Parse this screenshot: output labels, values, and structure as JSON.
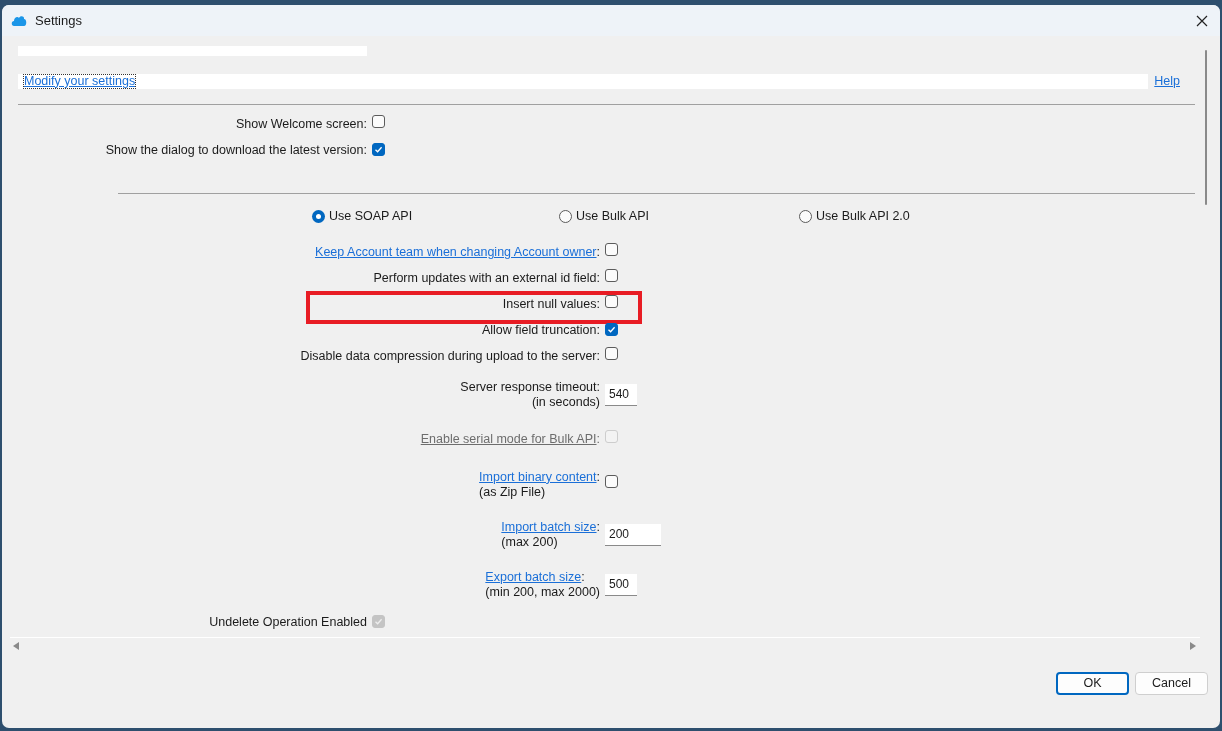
{
  "window": {
    "title": "Settings"
  },
  "header": {
    "link": "Modify your settings",
    "help": "Help"
  },
  "general": [
    {
      "label": "Show Welcome screen:",
      "checked": false
    },
    {
      "label": "Show the dialog to download the latest version:",
      "checked": true
    }
  ],
  "api_modes": [
    {
      "label": "Use SOAP API",
      "selected": true
    },
    {
      "label": "Use Bulk API",
      "selected": false
    },
    {
      "label": "Use Bulk API 2.0",
      "selected": false
    }
  ],
  "options": [
    {
      "kind": "checkbox",
      "text": "Keep Account team when changing Account owner",
      "suffix": ":",
      "link": true,
      "checked": false,
      "disabled": false
    },
    {
      "kind": "checkbox",
      "text": "Perform updates with an external id field:",
      "link": false,
      "checked": false,
      "disabled": false
    },
    {
      "kind": "checkbox",
      "text": "Insert null values:",
      "link": false,
      "checked": false,
      "disabled": false,
      "highlighted": true
    },
    {
      "kind": "checkbox",
      "text": "Allow field truncation:",
      "link": false,
      "checked": true,
      "disabled": false
    },
    {
      "kind": "checkbox",
      "text": "Disable data compression during upload to the server:",
      "link": false,
      "checked": false,
      "disabled": false
    },
    {
      "kind": "number",
      "text": "Server response timeout:",
      "note": "(in seconds)",
      "link": false,
      "value": "540",
      "wide": false
    },
    {
      "kind": "checkbox",
      "text": "Enable serial mode for Bulk API",
      "suffix": ":",
      "link": true,
      "checked": false,
      "disabled": true
    },
    {
      "kind": "checkbox",
      "text": "Import binary content",
      "suffix": ":",
      "note": "(as Zip File)",
      "link": true,
      "checked": false,
      "disabled": false
    },
    {
      "kind": "number",
      "text": "Import batch size",
      "suffix": ":",
      "note": "(max 200)",
      "link": true,
      "value": "200",
      "wide": true
    },
    {
      "kind": "number",
      "text": "Export batch size",
      "suffix": ":",
      "note": "(min 200, max 2000)",
      "link": true,
      "value": "500",
      "wide": false
    }
  ],
  "footer_options": [
    {
      "label": "Undelete Operation Enabled",
      "checked": true,
      "disabled": true
    }
  ],
  "buttons": [
    {
      "label": "OK",
      "default": true
    },
    {
      "label": "Cancel",
      "default": false
    }
  ]
}
